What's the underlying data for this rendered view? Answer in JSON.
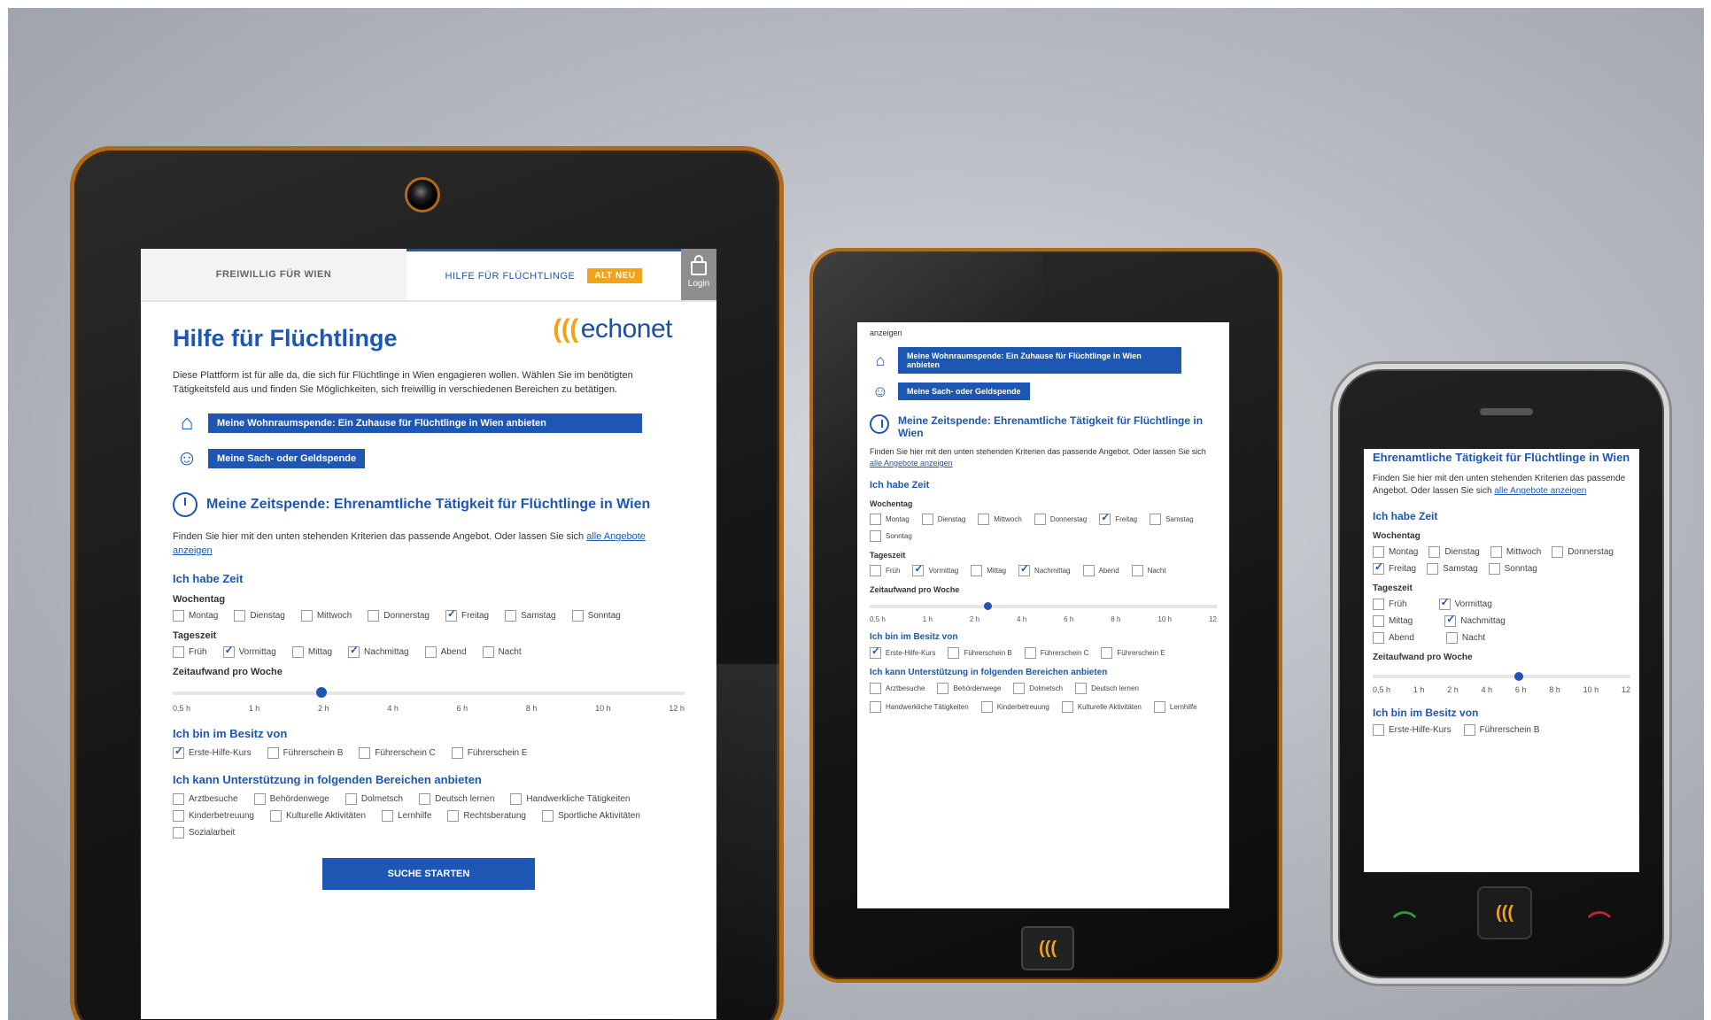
{
  "tablet_large": {
    "tabs": [
      {
        "label": "FREIWILLIG FÜR WIEN"
      },
      {
        "label": "HILFE FÜR FLÜCHTLINGE",
        "badge": "ALT NEU"
      }
    ],
    "login": "Login",
    "logo": "echonet",
    "title": "Hilfe für Flüchtlinge",
    "intro": "Diese Plattform ist für alle da, die sich für Flüchtlinge in Wien engagieren wollen. Wählen Sie im benötigten Tätigkeitsfeld aus und finden Sie Möglichkeiten, sich freiwillig in verschiedenen Bereichen zu betätigen.",
    "bar1": "Meine Wohnraumspende: Ein Zuhause für Flüchtlinge in Wien anbieten",
    "bar2": "Meine Sach- oder Geldspende",
    "section_title": "Meine Zeitspende: Ehrenamtliche Tätigkeit für Flüchtlinge in Wien",
    "section_text": "Finden Sie hier mit den unten stehenden Kriterien das passende Angebot. Oder lassen Sie sich",
    "section_link": "alle Angebote anzeigen",
    "ich_habe_zeit": "Ich habe Zeit",
    "wochentag_label": "Wochentag",
    "wochentage": [
      {
        "label": "Montag",
        "checked": false
      },
      {
        "label": "Dienstag",
        "checked": false
      },
      {
        "label": "Mittwoch",
        "checked": false
      },
      {
        "label": "Donnerstag",
        "checked": false
      },
      {
        "label": "Freitag",
        "checked": true
      },
      {
        "label": "Samstag",
        "checked": false
      },
      {
        "label": "Sonntag",
        "checked": false
      }
    ],
    "tageszeit_label": "Tageszeit",
    "tageszeiten": [
      {
        "label": "Früh",
        "checked": false
      },
      {
        "label": "Vormittag",
        "checked": true
      },
      {
        "label": "Mittag",
        "checked": false
      },
      {
        "label": "Nachmittag",
        "checked": true
      },
      {
        "label": "Abend",
        "checked": false
      },
      {
        "label": "Nacht",
        "checked": false
      }
    ],
    "zeitaufwand_label": "Zeitaufwand pro Woche",
    "slider_ticks": [
      "0,5 h",
      "1 h",
      "2 h",
      "4 h",
      "6 h",
      "8 h",
      "10 h",
      "12 h"
    ],
    "slider_value_fraction": 0.28,
    "besitz_title": "Ich bin im Besitz von",
    "besitz": [
      {
        "label": "Erste-Hilfe-Kurs",
        "checked": true
      },
      {
        "label": "Führerschein B",
        "checked": false
      },
      {
        "label": "Führerschein C",
        "checked": false
      },
      {
        "label": "Führerschein E",
        "checked": false
      }
    ],
    "bereiche_title": "Ich kann Unterstützung in folgenden Bereichen anbieten",
    "bereiche": [
      {
        "label": "Arztbesuche",
        "checked": false
      },
      {
        "label": "Behördenwege",
        "checked": false
      },
      {
        "label": "Dolmetsch",
        "checked": false
      },
      {
        "label": "Deutsch lernen",
        "checked": false
      },
      {
        "label": "Handwerkliche Tätigkeiten",
        "checked": false
      },
      {
        "label": "Kinderbetreuung",
        "checked": false
      },
      {
        "label": "Kulturelle Aktivitäten",
        "checked": false
      },
      {
        "label": "Lernhilfe",
        "checked": false
      },
      {
        "label": "Rechtsberatung",
        "checked": false
      },
      {
        "label": "Sportliche Aktivitäten",
        "checked": false
      },
      {
        "label": "Sozialarbeit",
        "checked": false
      }
    ],
    "cta": "SUCHE STARTEN"
  },
  "tablet_small": {
    "top_text": "anzeigen",
    "bar1": "Meine Wohnraumspende: Ein Zuhause für Flüchtlinge in Wien anbieten",
    "bar2": "Meine Sach- oder Geldspende",
    "section_title": "Meine Zeitspende: Ehrenamtliche Tätigkeit für Flüchtlinge in Wien",
    "section_text": "Finden Sie hier mit den unten stehenden Kriterien das passende Angebot. Oder lassen Sie sich",
    "section_link": "alle Angebote anzeigen",
    "ich_habe_zeit": "Ich habe Zeit",
    "wochentag_label": "Wochentag",
    "wochentage": [
      {
        "label": "Montag",
        "checked": false
      },
      {
        "label": "Dienstag",
        "checked": false
      },
      {
        "label": "Mittwoch",
        "checked": false
      },
      {
        "label": "Donnerstag",
        "checked": false
      },
      {
        "label": "Freitag",
        "checked": true
      },
      {
        "label": "Samstag",
        "checked": false
      },
      {
        "label": "Sonntag",
        "checked": false
      }
    ],
    "tageszeit_label": "Tageszeit",
    "tageszeiten": [
      {
        "label": "Früh",
        "checked": false
      },
      {
        "label": "Vormittag",
        "checked": true
      },
      {
        "label": "Mittag",
        "checked": false
      },
      {
        "label": "Nachmittag",
        "checked": true
      },
      {
        "label": "Abend",
        "checked": false
      },
      {
        "label": "Nacht",
        "checked": false
      }
    ],
    "zeitaufwand_label": "Zeitaufwand pro Woche",
    "slider_ticks": [
      "0,5 h",
      "1 h",
      "2 h",
      "4 h",
      "6 h",
      "8 h",
      "10 h",
      "12"
    ],
    "slider_value_fraction": 0.33,
    "besitz_title": "Ich bin im Besitz von",
    "besitz": [
      {
        "label": "Erste-Hilfe-Kurs",
        "checked": true
      },
      {
        "label": "Führerschein B",
        "checked": false
      },
      {
        "label": "Führerschein C",
        "checked": false
      },
      {
        "label": "Führerschein E",
        "checked": false
      }
    ],
    "bereiche_title": "Ich kann Unterstützung in folgenden Bereichen anbieten",
    "bereiche": [
      {
        "label": "Arztbesuche",
        "checked": false
      },
      {
        "label": "Behördenwege",
        "checked": false
      },
      {
        "label": "Dolmetsch",
        "checked": false
      },
      {
        "label": "Deutsch lernen",
        "checked": false
      },
      {
        "label": "Handwerkliche Tätigkeiten",
        "checked": false
      },
      {
        "label": "Kinderbetreuung",
        "checked": false
      },
      {
        "label": "Kulturelle Aktivitäten",
        "checked": false
      },
      {
        "label": "Lernhilfe",
        "checked": false
      }
    ]
  },
  "phone": {
    "title": "Ehrenamtliche Tätigkeit für Flüchtlinge in Wien",
    "section_text": "Finden Sie hier mit den unten stehenden Kriterien das passende Angebot. Oder lassen Sie sich",
    "section_link": "alle Angebote anzeigen",
    "ich_habe_zeit": "Ich habe Zeit",
    "wochentag_label": "Wochentag",
    "wochentage": [
      {
        "label": "Montag",
        "checked": false
      },
      {
        "label": "Dienstag",
        "checked": false
      },
      {
        "label": "Mittwoch",
        "checked": false
      },
      {
        "label": "Donnerstag",
        "checked": false
      },
      {
        "label": "Freitag",
        "checked": true
      },
      {
        "label": "Samstag",
        "checked": false
      },
      {
        "label": "Sonntag",
        "checked": false
      }
    ],
    "tageszeit_label": "Tageszeit",
    "tageszeiten": [
      {
        "label": "Früh",
        "checked": false
      },
      {
        "label": "Vormittag",
        "checked": true
      },
      {
        "label": "Mittag",
        "checked": false
      },
      {
        "label": "Nachmittag",
        "checked": true
      },
      {
        "label": "Abend",
        "checked": false
      },
      {
        "label": "Nacht",
        "checked": false
      }
    ],
    "zeitaufwand_label": "Zeitaufwand pro Woche",
    "slider_ticks": [
      "0,5 h",
      "1 h",
      "2 h",
      "4 h",
      "6 h",
      "8 h",
      "10 h",
      "12"
    ],
    "slider_value_fraction": 0.55,
    "besitz_title": "Ich bin im Besitz von",
    "besitz": [
      {
        "label": "Erste-Hilfe-Kurs",
        "checked": false
      },
      {
        "label": "Führerschein B",
        "checked": false
      }
    ]
  },
  "colors": {
    "accent": "#1d56b3",
    "brand_orange": "#f2a21b",
    "frame_orange": "#b06a1b"
  },
  "icons": {
    "home": "echonet-logo-icon",
    "wohnraum": "house-hand-icon",
    "sach": "people-icon",
    "zeit": "clock-icon"
  }
}
